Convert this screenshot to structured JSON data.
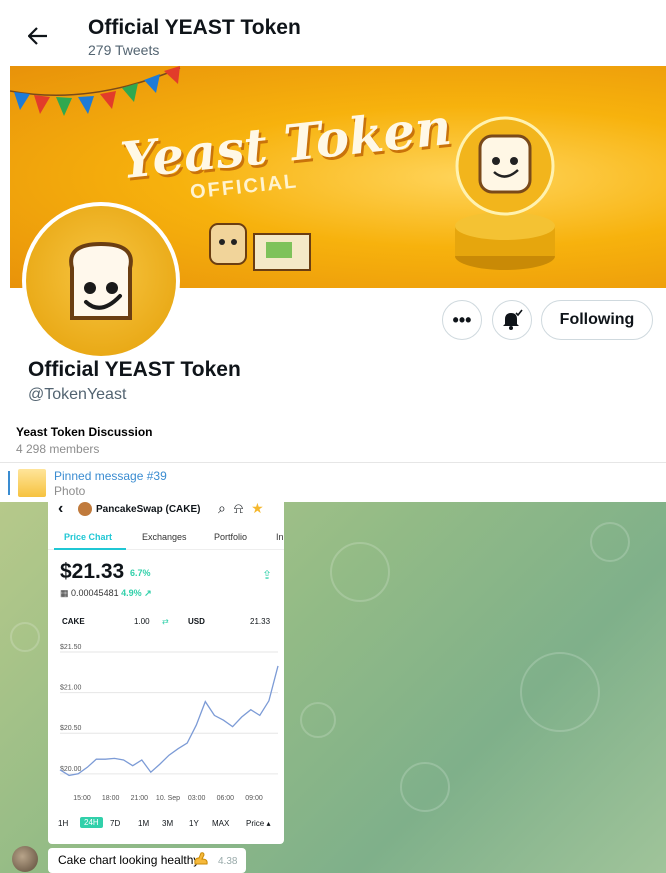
{
  "twitter": {
    "title": "Official YEAST Token",
    "tweets": "279 Tweets",
    "banner_title": "Yeast Token",
    "banner_sub": "OFFICIAL",
    "name": "Official YEAST Token",
    "handle": "@TokenYeast",
    "follow_label": "Following",
    "more_label": "•••"
  },
  "telegram": {
    "group_title": "Yeast Token Discussion",
    "members": "4 298 members",
    "pinned_title": "Pinned message #39",
    "pinned_sub": "Photo"
  },
  "phone": {
    "back": "‹",
    "pair": "PancakeSwap (CAKE)",
    "tabs": [
      "Price Chart",
      "Exchanges",
      "Portfolio",
      "In"
    ],
    "price": "$21.33",
    "price_change": "6.7%",
    "bnb_value": "0.00045481",
    "bnb_change": "4.9% ↗",
    "conv_from_label": "CAKE",
    "conv_from_value": "1.00",
    "conv_to_label": "USD",
    "conv_to_value": "21.33",
    "ranges": [
      "1H",
      "24H",
      "7D",
      "1M",
      "3M",
      "1Y",
      "MAX",
      "Price ▴"
    ]
  },
  "chart_data": {
    "type": "line",
    "title": "",
    "xlabel": "",
    "ylabel": "",
    "x_ticks": [
      "15:00",
      "18:00",
      "21:00",
      "10. Sep",
      "03:00",
      "06:00",
      "09:00"
    ],
    "y_ticks": [
      "$21.50",
      "$21.00",
      "$20.50",
      "$20.00"
    ],
    "ylim": [
      19.85,
      21.55
    ],
    "series": [
      {
        "values": [
          20.05,
          19.98,
          20.0,
          20.08,
          20.18,
          20.18,
          20.19,
          20.17,
          20.1,
          20.17,
          20.02,
          20.12,
          20.23,
          20.31,
          20.38,
          20.6,
          20.89,
          20.72,
          20.66,
          20.58,
          20.7,
          20.79,
          20.72,
          20.9,
          21.33
        ]
      }
    ]
  },
  "message": {
    "text": "Cake chart looking healthy",
    "time": "4.38"
  },
  "colors": {
    "twitter_border": "#cfd9de",
    "telegram_blue": "#3a8cd1",
    "pancake_teal": "#1fc7d4",
    "pancake_green": "#31d0aa",
    "chart_line": "#7c9bd6"
  }
}
